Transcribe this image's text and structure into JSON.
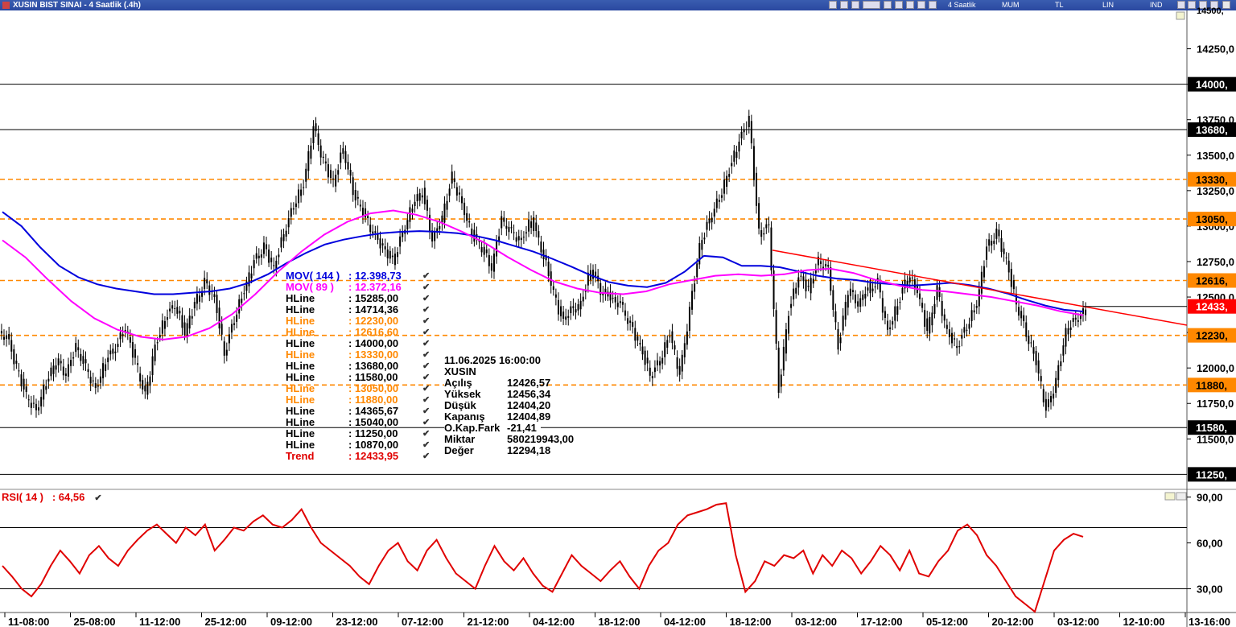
{
  "window": {
    "title": "XUSIN BIST SINAI - 4 Saatlik (.4h)",
    "toolbar": [
      "4 Saatlik",
      "MUM",
      "TL",
      "LIN",
      "IND"
    ]
  },
  "colors": {
    "mov144": "#0000dd",
    "mov89": "#ff00ff",
    "hline_black": "#000000",
    "hline_orange": "#ff8800",
    "trend": "#ff0000",
    "rsi": "#e00000",
    "label_bg": "#000000",
    "label_orange": "#ff8800",
    "label_red": "#ff0000"
  },
  "price_axis": {
    "ticks": [
      "14250,0",
      "14000,",
      "13750,0",
      "13500,0",
      "13250,0",
      "13000,0",
      "12750,0",
      "12500,0",
      "12250,0",
      "12000,0",
      "11750,0",
      "11500,0"
    ],
    "tick_values": [
      14250,
      14000,
      13750,
      13500,
      13250,
      13000,
      12750,
      12500,
      12250,
      12000,
      11750,
      11500
    ],
    "top_cut_label": "14500,"
  },
  "level_labels": [
    {
      "text": "14000,",
      "value": 14000,
      "color": "black"
    },
    {
      "text": "13680,",
      "value": 13680,
      "color": "black"
    },
    {
      "text": "13330,",
      "value": 13330,
      "color": "orange"
    },
    {
      "text": "13050,",
      "value": 13050,
      "color": "orange"
    },
    {
      "text": "12616,",
      "value": 12616.6,
      "color": "orange"
    },
    {
      "text": "12433,",
      "value": 12433.95,
      "color": "red"
    },
    {
      "text": "12230,",
      "value": 12230,
      "color": "orange"
    },
    {
      "text": "11880,",
      "value": 11880,
      "color": "orange"
    },
    {
      "text": "11580,",
      "value": 11580,
      "color": "black"
    },
    {
      "text": "11250,",
      "value": 11250,
      "color": "black"
    }
  ],
  "x_axis": [
    "11-08:00",
    "25-08:00",
    "11-12:00",
    "25-12:00",
    "09-12:00",
    "23-12:00",
    "07-12:00",
    "21-12:00",
    "04-12:00",
    "18-12:00",
    "04-12:00",
    "18-12:00",
    "03-12:00",
    "17-12:00",
    "05-12:00",
    "20-12:00",
    "03-12:00",
    "12-10:00",
    "13-16:00"
  ],
  "legend": [
    {
      "name": "MOV( 144 )",
      "value": ": 12.398,73",
      "color": "blue"
    },
    {
      "name": "MOV( 89 )",
      "value": ": 12.372,16",
      "color": "magenta"
    },
    {
      "name": "HLine",
      "value": ": 15285,00",
      "color": "black"
    },
    {
      "name": "HLine",
      "value": ": 14714,36",
      "color": "black"
    },
    {
      "name": "HLine",
      "value": ": 12230,00",
      "color": "orange"
    },
    {
      "name": "HLine",
      "value": ": 12616,60",
      "color": "orange"
    },
    {
      "name": "HLine",
      "value": ": 14000,00",
      "color": "black"
    },
    {
      "name": "HLine",
      "value": ": 13330,00",
      "color": "orange"
    },
    {
      "name": "HLine",
      "value": ": 13680,00",
      "color": "black"
    },
    {
      "name": "HLine",
      "value": ": 11580,00",
      "color": "black"
    },
    {
      "name": "HLine",
      "value": ": 13050,00",
      "color": "orange"
    },
    {
      "name": "HLine",
      "value": ": 11880,00",
      "color": "orange"
    },
    {
      "name": "HLine",
      "value": ": 14365,67",
      "color": "black"
    },
    {
      "name": "HLine",
      "value": ": 15040,00",
      "color": "black"
    },
    {
      "name": "HLine",
      "value": ": 11250,00",
      "color": "black"
    },
    {
      "name": "HLine",
      "value": ": 10870,00",
      "color": "black"
    },
    {
      "name": "Trend",
      "value": ": 12433,95",
      "color": "red"
    }
  ],
  "info": [
    {
      "k": "11.06.2025  16:00:00",
      "v": ""
    },
    {
      "k": "XUSIN",
      "v": ""
    },
    {
      "k": "Açılış",
      "v": "12426,57"
    },
    {
      "k": "Yüksek",
      "v": "12456,34"
    },
    {
      "k": "Düşük",
      "v": "12404,20"
    },
    {
      "k": "Kapanış",
      "v": "12404,89"
    },
    {
      "k": "O.Kap.Fark",
      "v": "-21,41"
    },
    {
      "k": "Miktar",
      "v": "580219943,00"
    },
    {
      "k": "Değer",
      "v": "12294,18"
    }
  ],
  "rsi": {
    "label": "RSI( 14 )",
    "value": ": 64,56",
    "ticks": [
      "90,00",
      "60,00",
      "30,00"
    ],
    "tick_values": [
      90,
      60,
      30
    ],
    "levels": [
      70,
      30
    ]
  },
  "chart_data": {
    "type": "line",
    "title": "XUSIN BIST SINAI - 4 Saatlik (.4h)",
    "ylim": [
      11150,
      14520
    ],
    "price_close": [
      12230,
      12000,
      11800,
      11700,
      11900,
      12050,
      11950,
      12150,
      12000,
      11850,
      12050,
      12150,
      12280,
      12050,
      11800,
      12150,
      12350,
      12450,
      12250,
      12450,
      12600,
      12500,
      12100,
      12350,
      12550,
      12750,
      12850,
      12700,
      12950,
      13150,
      13300,
      13700,
      13450,
      13300,
      13550,
      13250,
      13100,
      12950,
      12850,
      12750,
      12950,
      13150,
      13250,
      12900,
      13050,
      13350,
      13150,
      12950,
      12850,
      12700,
      13050,
      12950,
      12900,
      13050,
      12850,
      12600,
      12350,
      12400,
      12450,
      12700,
      12550,
      12500,
      12450,
      12300,
      12150,
      11950,
      12050,
      12250,
      11950,
      12400,
      12850,
      13050,
      13200,
      13400,
      13600,
      13750,
      12950,
      13000,
      11850,
      12400,
      12650,
      12550,
      12750,
      12700,
      12150,
      12550,
      12450,
      12550,
      12600,
      12250,
      12450,
      12650,
      12550,
      12250,
      12550,
      12250,
      12150,
      12300,
      12450,
      12850,
      12950,
      12750,
      12450,
      12250,
      12050,
      11700,
      11900,
      12250,
      12350,
      12400
    ],
    "mov144": [
      13100,
      13000,
      12850,
      12720,
      12640,
      12590,
      12560,
      12540,
      12520,
      12520,
      12530,
      12540,
      12560,
      12600,
      12660,
      12740,
      12810,
      12870,
      12905,
      12930,
      12950,
      12960,
      12965,
      12960,
      12950,
      12930,
      12900,
      12860,
      12820,
      12770,
      12715,
      12655,
      12605,
      12580,
      12570,
      12600,
      12680,
      12790,
      12780,
      12720,
      12720,
      12710,
      12680,
      12650,
      12630,
      12620,
      12600,
      12590,
      12580,
      12590,
      12600,
      12585,
      12560,
      12525,
      12480,
      12440,
      12410,
      12398
    ],
    "mov89": [
      12900,
      12780,
      12620,
      12470,
      12350,
      12270,
      12220,
      12200,
      12220,
      12280,
      12380,
      12520,
      12680,
      12820,
      12940,
      13030,
      13090,
      13110,
      13080,
      13030,
      12960,
      12880,
      12780,
      12690,
      12610,
      12560,
      12530,
      12520,
      12540,
      12590,
      12620,
      12650,
      12660,
      12650,
      12660,
      12690,
      12700,
      12670,
      12620,
      12580,
      12550,
      12540,
      12520,
      12500,
      12470,
      12440,
      12400,
      12372
    ],
    "trend_line": [
      {
        "x": 960,
        "y": 12830
      },
      {
        "x": 1346,
        "y": 12433.95
      }
    ],
    "horizontal_lines": [
      14000,
      13680,
      13330,
      13050,
      12616.6,
      12230,
      11880,
      11580,
      11250
    ],
    "rsi_values": [
      45,
      38,
      30,
      25,
      33,
      45,
      55,
      48,
      40,
      52,
      58,
      50,
      45,
      55,
      62,
      68,
      72,
      66,
      60,
      70,
      65,
      72,
      55,
      62,
      70,
      68,
      74,
      78,
      72,
      70,
      75,
      82,
      70,
      60,
      55,
      50,
      45,
      38,
      33,
      45,
      55,
      60,
      48,
      42,
      55,
      62,
      50,
      40,
      35,
      30,
      45,
      58,
      48,
      42,
      50,
      40,
      32,
      28,
      40,
      52,
      45,
      40,
      35,
      42,
      48,
      38,
      30,
      45,
      55,
      60,
      72,
      78,
      80,
      82,
      85,
      86,
      52,
      28,
      35,
      48,
      45,
      52,
      50,
      55,
      40,
      52,
      45,
      55,
      50,
      40,
      48,
      58,
      52,
      42,
      55,
      40,
      38,
      48,
      55,
      68,
      72,
      65,
      52,
      45,
      35,
      25,
      20,
      15,
      35,
      55,
      62,
      66,
      64
    ]
  }
}
